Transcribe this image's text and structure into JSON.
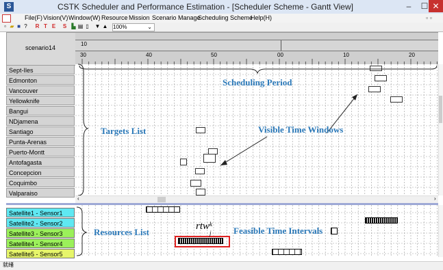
{
  "window": {
    "title": "CSTK Scheduler and Performance Estimation - [Scheduler Scheme - Gantt View]",
    "minimize": "–",
    "maximize": "☐",
    "close": "✕"
  },
  "menu": [
    "File(F)",
    "Vision(V)",
    "Window(W)",
    "Resource",
    "Mission",
    "Scenario Manage",
    "Scheduling Scheme",
    "Help(H)"
  ],
  "toolbar": {
    "letters": [
      "R",
      "T",
      "E",
      "S"
    ],
    "zoom": "100%"
  },
  "scenario": "scenario14",
  "timeline": {
    "top_label": "10",
    "ticks": [
      "30",
      "40",
      "50",
      "00",
      "10",
      "20"
    ]
  },
  "targets": [
    "Sept-Iles",
    "Edmonton",
    "Vancouver",
    "Yellowknife",
    "Bangui",
    "NDjamena",
    "Santiago",
    "Punta-Arenas",
    "Puerto-Montt",
    "Antofagasta",
    "Concepcion",
    "Coquimbo",
    "Valparaiso"
  ],
  "resources": [
    "Satellite1 - Sensor1",
    "Satellite2 - Sensor2",
    "Satellite3 - Sensor3",
    "Satellite4 - Sensor4",
    "Satellite5 - Sensor5"
  ],
  "annotations": {
    "scheduling_period": "Scheduling Period",
    "targets_list": "Targets List",
    "visible_time_windows": "Visible Time Windows",
    "resources_list": "Resources List",
    "feasible_time_intervals": "Feasible Time Intervals",
    "rtw": "rtw",
    "rtw_sup": "k",
    "rtw_sub": "j"
  },
  "status": "就绪",
  "colors": {
    "resource_cyan": "#5fe8f2",
    "resource_green": "#9bf05a",
    "resource_yellow": "#e6f56a",
    "annotation_blue": "#2a78b8",
    "highlight_red": "#e02020"
  }
}
